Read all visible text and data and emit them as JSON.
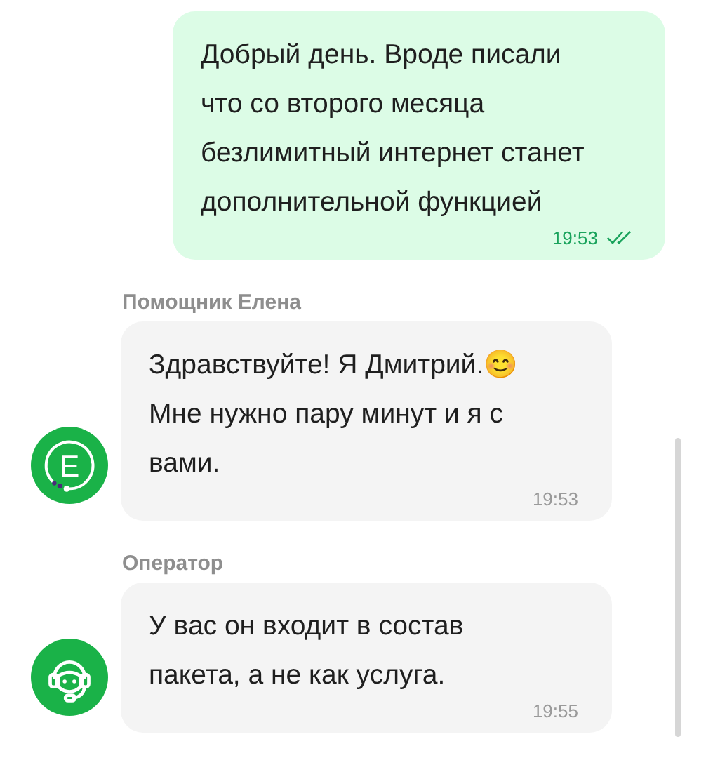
{
  "messages": [
    {
      "kind": "outgoing",
      "text": "Добрый день. Вроде писали\nчто со второго месяца\nбезлимитный интернет станет\nдополнительной функцией",
      "time": "19:53",
      "read": true
    },
    {
      "kind": "incoming",
      "sender": "Помощник Елена",
      "avatar": {
        "kind": "letter",
        "letter": "E"
      },
      "text": "Здравствуйте! Я Дмитрий.😊\nМне нужно пару минут и я с\nвами.",
      "time": "19:53"
    },
    {
      "kind": "incoming",
      "sender": "Оператор",
      "avatar": {
        "kind": "operator"
      },
      "text": "У вас он входит в состав\nпакета, а не как услуга.",
      "time": "19:55"
    }
  ]
}
